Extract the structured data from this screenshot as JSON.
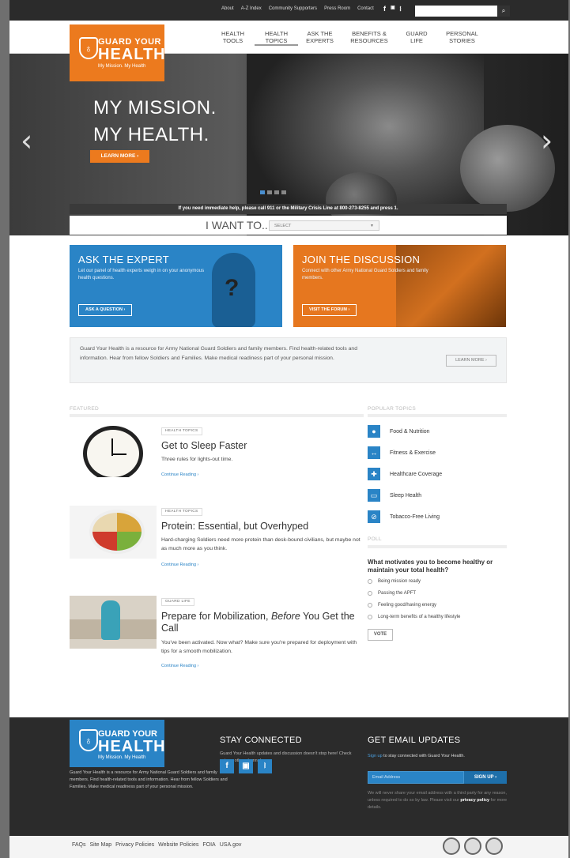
{
  "utility_nav": [
    "About",
    "A-Z Index",
    "Community Supporters",
    "Press Room",
    "Contact"
  ],
  "social_top": {
    "facebook": "f",
    "youtube": "You",
    "rss": "rss"
  },
  "search": {
    "button": "search-icon"
  },
  "logo": {
    "line1": "GUARD YOUR",
    "line2": "HEALTH",
    "tagline": "My Mission. My Health"
  },
  "main_nav": [
    {
      "l1": "HEALTH",
      "l2": "TOOLS"
    },
    {
      "l1": "HEALTH",
      "l2": "TOPICS"
    },
    {
      "l1": "ASK THE",
      "l2": "EXPERTS"
    },
    {
      "l1": "BENEFITS &",
      "l2": "RESOURCES"
    },
    {
      "l1": "GUARD",
      "l2": "LIFE"
    },
    {
      "l1": "PERSONAL",
      "l2": "STORIES"
    }
  ],
  "hero": {
    "line1": "MY MISSION.",
    "line2": "MY HEALTH.",
    "button": "LEARN MORE  ›",
    "crisis": "If you need immediate help, please call 911 or the Military Crisis Line at 800-273-8255 and press 1."
  },
  "iwant": {
    "label": "I WANT TO...",
    "select": "SELECT"
  },
  "promos": {
    "expert": {
      "title": "ASK THE EXPERT",
      "text": "Let our panel of health experts weigh in on your anonymous health questions.",
      "button": "ASK A QUESTION  ›"
    },
    "discussion": {
      "title": "JOIN THE DISCUSSION",
      "text": "Connect with other Army National Guard Soldiers and family members.",
      "button": "VISIT THE FORUM  ›"
    }
  },
  "about": {
    "text": "Guard Your Health is a resource for Army National Guard Soldiers and family members. Find health-related tools and information. Hear from fellow Soldiers and Families. Make medical readiness part of your personal mission.",
    "button": "LEARN MORE  ›"
  },
  "featured": {
    "heading": "FEATURED",
    "items": [
      {
        "tag": "HEALTH TOPICS",
        "title": "Get to Sleep Faster",
        "desc": "Three rules for lights-out time.",
        "link": "Continue Reading ›"
      },
      {
        "tag": "HEALTH TOPICS",
        "title": "Protein: Essential, but Overhyped",
        "desc": "Hard-charging Soldiers need more protein than desk-bound civilians, but maybe not as much more as you think.",
        "link": "Continue Reading ›"
      },
      {
        "tag": "GUARD LIFE",
        "title_a": "Prepare for Mobilization, ",
        "title_b": "Before",
        "title_c": " You Get the Call",
        "desc": "You've been activated. Now what? Make sure you're prepared for deployment with tips for a smooth mobilization.",
        "link": "Continue Reading ›"
      }
    ]
  },
  "popular": {
    "heading": "POPULAR TOPICS",
    "items": [
      {
        "label": "Food & Nutrition",
        "icon": "apple-icon"
      },
      {
        "label": "Fitness & Exercise",
        "icon": "dumbbell-icon"
      },
      {
        "label": "Healthcare Coverage",
        "icon": "cross-icon"
      },
      {
        "label": "Sleep Health",
        "icon": "bed-icon"
      },
      {
        "label": "Tobacco-Free Living",
        "icon": "no-smoking-icon"
      }
    ]
  },
  "poll": {
    "heading": "POLL",
    "question": "What motivates you to become healthy or maintain your total health?",
    "options": [
      "Being mission ready",
      "Passing the APFT",
      "Feeling good/having energy",
      "Long-term benefits of a healthy lifestyle"
    ],
    "button": "VOTE"
  },
  "footer": {
    "desc": "Guard Your Health is a resource for Army National Guard Soldiers and family members. Find health-related tools and information. Hear from fellow Soldiers and Families. Make medical readiness part of your personal mission.",
    "stay_title": "STAY CONNECTED",
    "stay_text": "Guard Your Health updates and discussion doesn't stop here! Check out our other channels.",
    "email_title": "GET EMAIL UPDATES",
    "email_link": "Sign up",
    "email_text": " to stay connected with Guard Your Health.",
    "email_placeholder": "Email Address",
    "signup": "SIGN UP  ›",
    "privacy_a": "We will never share your email address with a third party for any reason, unless required to do so by law. Please visit our ",
    "privacy_b": "privacy policy",
    "privacy_c": " for more details."
  },
  "bottom_links": [
    "FAQs",
    "Site Map",
    "Privacy Policies",
    "Website Policies",
    "FOIA",
    "USA.gov"
  ],
  "colors": {
    "orange": "#ec7a1e",
    "blue": "#2a84c6",
    "dark": "#2b2b2b"
  }
}
